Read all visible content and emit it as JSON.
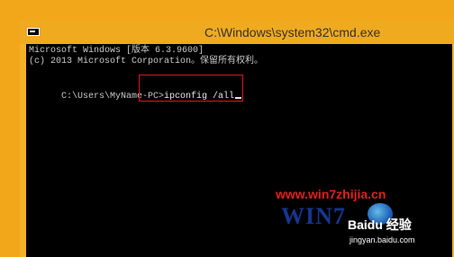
{
  "window": {
    "title": "C:\\Windows\\system32\\cmd.exe",
    "icon": "console-icon"
  },
  "console": {
    "lines": [
      "Microsoft Windows [版本 6.3.9600]",
      "(c) 2013 Microsoft Corporation。保留所有权利。"
    ],
    "prompt": "C:\\Users\\MyName-PC>",
    "command": "ipconfig /all"
  },
  "watermark": {
    "site_url": "www.win7zhijia.cn",
    "logo_text": "WIN7",
    "baidu_text": "Baidu 经验",
    "jingyan_url": "jingyan.baidu.com"
  },
  "colors": {
    "desktop_bg": "#f2a71b",
    "console_bg": "#000000",
    "console_text": "#c8c8c8",
    "highlight_border": "#d7181e",
    "watermark_red": "#e0201a"
  }
}
